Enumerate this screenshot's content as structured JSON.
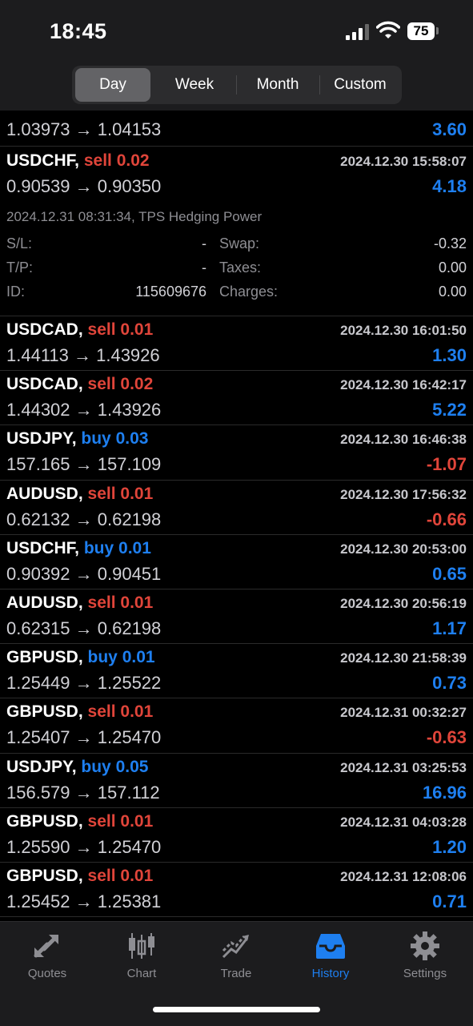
{
  "status": {
    "time": "18:45",
    "battery": "75"
  },
  "tabs": [
    "Day",
    "Week",
    "Month",
    "Custom"
  ],
  "active_tab": "Day",
  "partial_top": {
    "prices": "1.03973 → 1.04153",
    "profit": "3.60"
  },
  "expanded_trade": {
    "symbol": "USDCHF,",
    "side": "sell",
    "volume": "0.02",
    "datetime": "2024.12.30 15:58:07",
    "prices": "0.90539 → 0.90350",
    "profit": "4.18",
    "detail_header": "2024.12.31 08:31:34, TPS Hedging Power",
    "sl_label": "S/L:",
    "sl_value": "-",
    "tp_label": "T/P:",
    "tp_value": "-",
    "id_label": "ID:",
    "id_value": "115609676",
    "swap_label": "Swap:",
    "swap_value": "-0.32",
    "taxes_label": "Taxes:",
    "taxes_value": "0.00",
    "charges_label": "Charges:",
    "charges_value": "0.00"
  },
  "trades": [
    {
      "symbol": "USDCAD,",
      "side": "sell",
      "volume": "0.01",
      "datetime": "2024.12.30 16:01:50",
      "prices": "1.44113 → 1.43926",
      "profit": "1.30"
    },
    {
      "symbol": "USDCAD,",
      "side": "sell",
      "volume": "0.02",
      "datetime": "2024.12.30 16:42:17",
      "prices": "1.44302 → 1.43926",
      "profit": "5.22"
    },
    {
      "symbol": "USDJPY,",
      "side": "buy",
      "volume": "0.03",
      "datetime": "2024.12.30 16:46:38",
      "prices": "157.165 → 157.109",
      "profit": "-1.07"
    },
    {
      "symbol": "AUDUSD,",
      "side": "sell",
      "volume": "0.01",
      "datetime": "2024.12.30 17:56:32",
      "prices": "0.62132 → 0.62198",
      "profit": "-0.66"
    },
    {
      "symbol": "USDCHF,",
      "side": "buy",
      "volume": "0.01",
      "datetime": "2024.12.30 20:53:00",
      "prices": "0.90392 → 0.90451",
      "profit": "0.65"
    },
    {
      "symbol": "AUDUSD,",
      "side": "sell",
      "volume": "0.01",
      "datetime": "2024.12.30 20:56:19",
      "prices": "0.62315 → 0.62198",
      "profit": "1.17"
    },
    {
      "symbol": "GBPUSD,",
      "side": "buy",
      "volume": "0.01",
      "datetime": "2024.12.30 21:58:39",
      "prices": "1.25449 → 1.25522",
      "profit": "0.73"
    },
    {
      "symbol": "GBPUSD,",
      "side": "sell",
      "volume": "0.01",
      "datetime": "2024.12.31 00:32:27",
      "prices": "1.25407 → 1.25470",
      "profit": "-0.63"
    },
    {
      "symbol": "USDJPY,",
      "side": "buy",
      "volume": "0.05",
      "datetime": "2024.12.31 03:25:53",
      "prices": "156.579 → 157.112",
      "profit": "16.96"
    },
    {
      "symbol": "GBPUSD,",
      "side": "sell",
      "volume": "0.01",
      "datetime": "2024.12.31 04:03:28",
      "prices": "1.25590 → 1.25470",
      "profit": "1.20"
    },
    {
      "symbol": "GBPUSD,",
      "side": "sell",
      "volume": "0.01",
      "datetime": "2024.12.31 12:08:06",
      "prices": "1.25452 → 1.25381",
      "profit": "0.71"
    }
  ],
  "bottom_nav": [
    {
      "label": "Quotes",
      "icon": "quotes-icon"
    },
    {
      "label": "Chart",
      "icon": "chart-icon"
    },
    {
      "label": "Trade",
      "icon": "trade-icon"
    },
    {
      "label": "History",
      "icon": "history-icon"
    },
    {
      "label": "Settings",
      "icon": "settings-icon"
    }
  ],
  "active_nav": "History",
  "colors": {
    "buy": "#1e7ff0",
    "sell": "#e0453a",
    "active": "#1e7ff0"
  }
}
